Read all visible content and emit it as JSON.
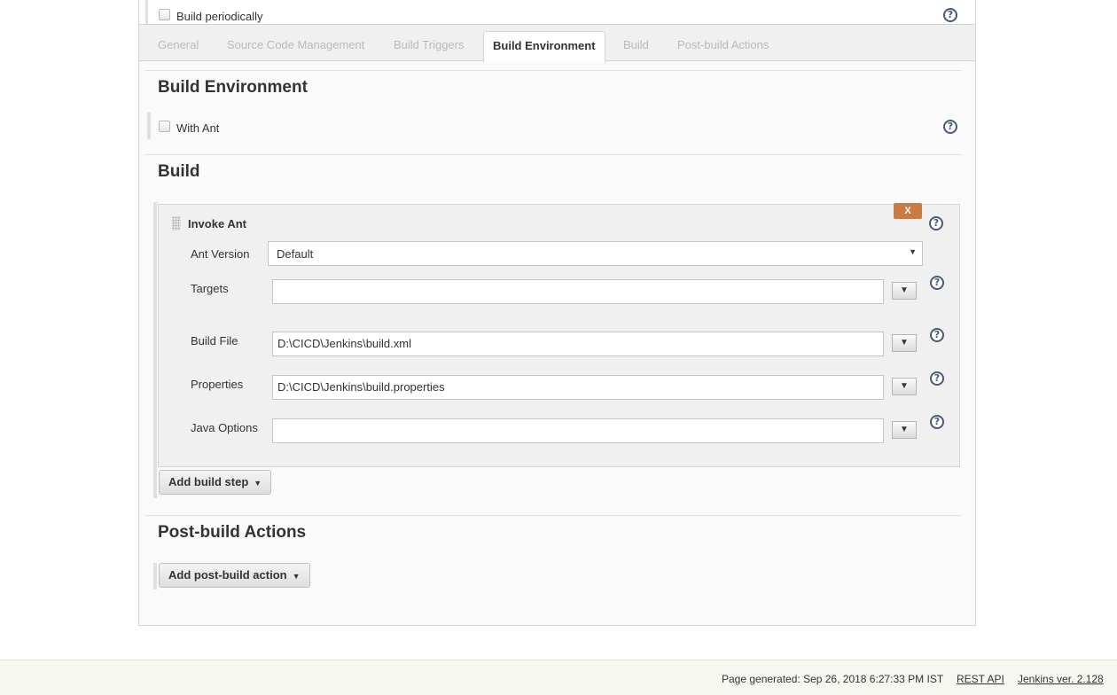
{
  "top": {
    "build_periodically_label": "Build periodically"
  },
  "tabs": [
    {
      "label": "General"
    },
    {
      "label": "Source Code Management"
    },
    {
      "label": "Build Triggers"
    },
    {
      "label": "Build Environment"
    },
    {
      "label": "Build"
    },
    {
      "label": "Post-build Actions"
    }
  ],
  "active_tab": "Build Environment",
  "build_environment": {
    "title": "Build Environment",
    "with_ant_label": "With Ant"
  },
  "build": {
    "title": "Build",
    "step": {
      "title": "Invoke Ant",
      "delete_label": "X",
      "ant_version_label": "Ant Version",
      "ant_version_value": "Default",
      "targets_label": "Targets",
      "targets_value": "",
      "build_file_label": "Build File",
      "build_file_value": "D:\\CICD\\Jenkins\\build.xml",
      "properties_label": "Properties",
      "properties_value": "D:\\CICD\\Jenkins\\build.properties",
      "java_options_label": "Java Options",
      "java_options_value": ""
    },
    "add_step_label": "Add build step"
  },
  "post_build": {
    "title": "Post-build Actions",
    "add_action_label": "Add post-build action"
  },
  "footer": {
    "generated": "Page generated: Sep 26, 2018 6:27:33 PM IST",
    "rest_api": "REST API",
    "version": "Jenkins ver. 2.128"
  },
  "icons": {
    "help": "help-icon",
    "dropdown": "dropdown-arrow-icon",
    "grip": "drag-handle-icon"
  }
}
